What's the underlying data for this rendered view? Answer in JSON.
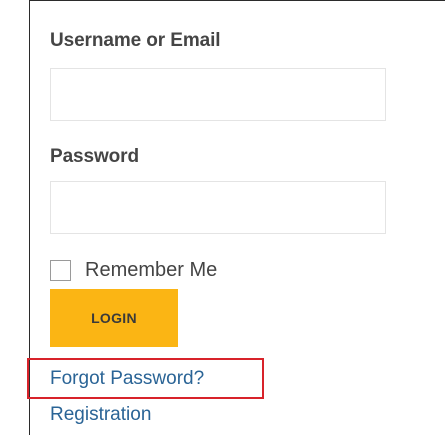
{
  "form": {
    "username_label": "Username or Email",
    "username_value": "",
    "password_label": "Password",
    "password_value": "",
    "remember_label": "Remember Me",
    "remember_checked": false,
    "login_label": "LOGIN"
  },
  "links": {
    "forgot_password": "Forgot Password?",
    "registration": "Registration"
  },
  "colors": {
    "login_button": "#fbb514",
    "link": "#2a6496",
    "highlight_border": "#d8232a",
    "label_text": "#454545"
  }
}
